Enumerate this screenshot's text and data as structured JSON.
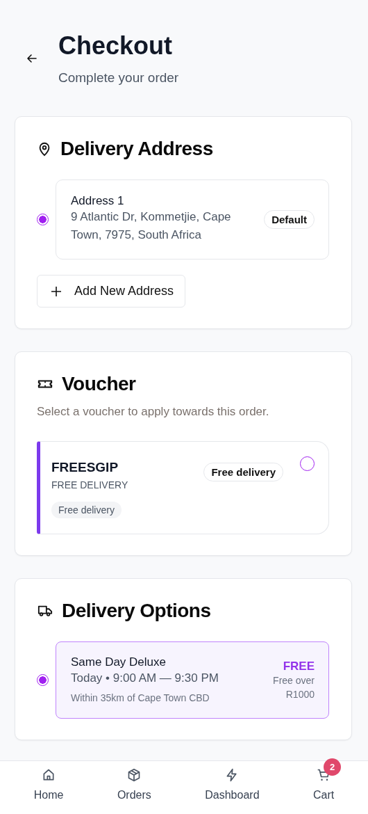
{
  "header": {
    "title": "Checkout",
    "subtitle": "Complete your order"
  },
  "address_section": {
    "title": "Delivery Address",
    "addresses": [
      {
        "name": "Address 1",
        "address": "9 Atlantic Dr, Kommetjie, Cape Town, 7975, South Africa",
        "badge": "Default",
        "selected": true
      }
    ],
    "add_button": "Add New Address"
  },
  "voucher_section": {
    "title": "Voucher",
    "description": "Select a voucher to apply towards this order.",
    "vouchers": [
      {
        "code": "FREESGIP",
        "type": "FREE DELIVERY",
        "tag": "Free delivery",
        "badge": "Free delivery",
        "selected": false
      }
    ]
  },
  "delivery_section": {
    "title": "Delivery Options",
    "options": [
      {
        "name": "Same Day Deluxe",
        "time": "Today • 9:00 AM — 9:30 PM",
        "note": "Within 35km of Cape Town CBD",
        "price": "FREE",
        "price_note": "Free over R1000",
        "selected": true
      }
    ]
  },
  "nav": {
    "items": [
      {
        "kind": "home",
        "label": "Home"
      },
      {
        "kind": "orders",
        "label": "Orders"
      },
      {
        "kind": "dashboard",
        "label": "Dashboard"
      },
      {
        "kind": "cart",
        "label": "Cart",
        "badge": "2"
      }
    ]
  }
}
